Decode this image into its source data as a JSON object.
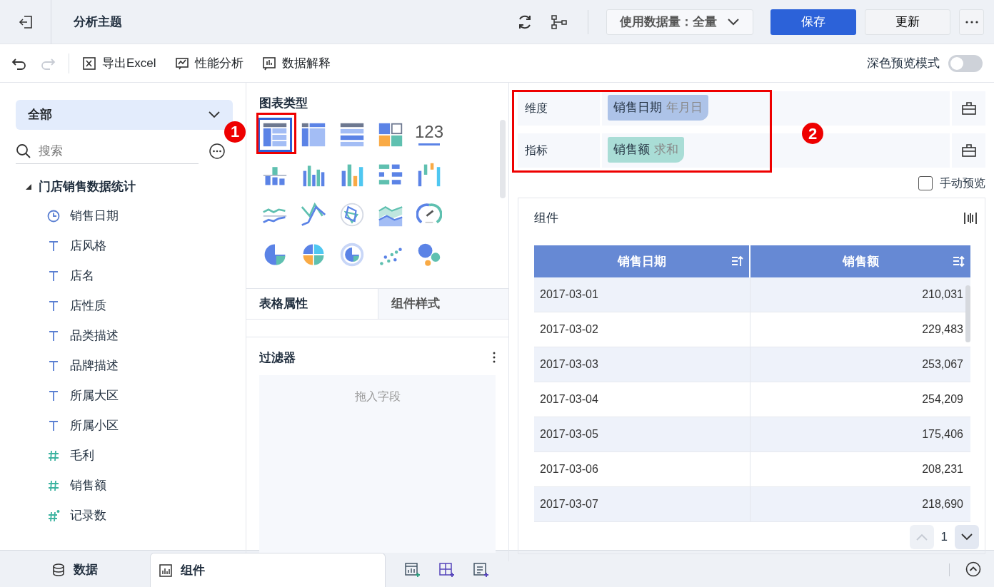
{
  "header": {
    "title": "分析主题",
    "data_volume": "使用数据量：全量",
    "save": "保存",
    "update": "更新"
  },
  "toolbar": {
    "redo_disabled": true,
    "items": [
      "导出Excel",
      "性能分析",
      "数据解释"
    ],
    "dark_preview": {
      "label": "深色预览模式",
      "on": false
    }
  },
  "sidebar": {
    "dropdown": "全部",
    "search": {
      "placeholder": "搜索"
    },
    "tree": {
      "label": "门店销售数据统计",
      "expanded": true,
      "children": [
        {
          "label": "销售日期",
          "kind": "date"
        },
        {
          "label": "店风格",
          "kind": "text"
        },
        {
          "label": "店名",
          "kind": "text"
        },
        {
          "label": "店性质",
          "kind": "text"
        },
        {
          "label": "品类描述",
          "kind": "text"
        },
        {
          "label": "品牌描述",
          "kind": "text"
        },
        {
          "label": "所属大区",
          "kind": "text"
        },
        {
          "label": "所属小区",
          "kind": "text"
        },
        {
          "label": "毛利",
          "kind": "number"
        },
        {
          "label": "销售额",
          "kind": "number"
        },
        {
          "label": "记录数",
          "kind": "count"
        }
      ]
    }
  },
  "chart_types": {
    "title": "图表类型",
    "items": [
      {
        "kind": "detail",
        "selected": true
      },
      {
        "kind": "group",
        "selected": false
      },
      {
        "kind": "cross",
        "selected": false
      },
      {
        "kind": "dashboard",
        "selected": false
      },
      {
        "kind": "kpi",
        "label": "123",
        "selected": false
      },
      {
        "kind": "stackbar",
        "selected": false
      },
      {
        "kind": "multibar",
        "selected": false
      },
      {
        "kind": "bar",
        "selected": false
      },
      {
        "kind": "hbar",
        "selected": false
      },
      {
        "kind": "waterfall",
        "selected": false
      },
      {
        "kind": "line",
        "selected": false
      },
      {
        "kind": "crossline",
        "selected": false
      },
      {
        "kind": "radar",
        "selected": false
      },
      {
        "kind": "area",
        "selected": false
      },
      {
        "kind": "gauge",
        "selected": false
      },
      {
        "kind": "pie",
        "selected": false
      },
      {
        "kind": "multipie",
        "selected": false
      },
      {
        "kind": "ring",
        "selected": false
      },
      {
        "kind": "scatter",
        "selected": false
      },
      {
        "kind": "bubble",
        "selected": false
      }
    ]
  },
  "callouts": [
    "1",
    "2"
  ],
  "property_tabs": [
    {
      "label": "表格属性",
      "selected": true
    },
    {
      "label": "组件样式",
      "selected": false
    }
  ],
  "filter": {
    "title": "过滤器",
    "placeholder": "拖入字段"
  },
  "fields": [
    {
      "label": "维度",
      "name": "销售日期",
      "aggregation": "年月日",
      "color": "#adc3e8"
    },
    {
      "label": "指标",
      "name": "销售额",
      "aggregation": "求和",
      "color": "#a9ddd6"
    }
  ],
  "manual_preview": {
    "label": "手动预览",
    "checked": false
  },
  "component": {
    "title": "组件",
    "columns": [
      {
        "label": "销售日期",
        "sorted": true
      },
      {
        "label": "销售额",
        "sorted": false
      }
    ],
    "rows": [
      [
        "2017-03-01",
        "210,031"
      ],
      [
        "2017-03-02",
        "229,483"
      ],
      [
        "2017-03-03",
        "253,067"
      ],
      [
        "2017-03-04",
        "254,209"
      ],
      [
        "2017-03-05",
        "175,406"
      ],
      [
        "2017-03-06",
        "208,231"
      ],
      [
        "2017-03-07",
        "218,690"
      ]
    ],
    "page": "1"
  },
  "bottom_tabs": [
    {
      "label": "数据",
      "selected": false
    },
    {
      "label": "组件",
      "selected": true
    }
  ]
}
